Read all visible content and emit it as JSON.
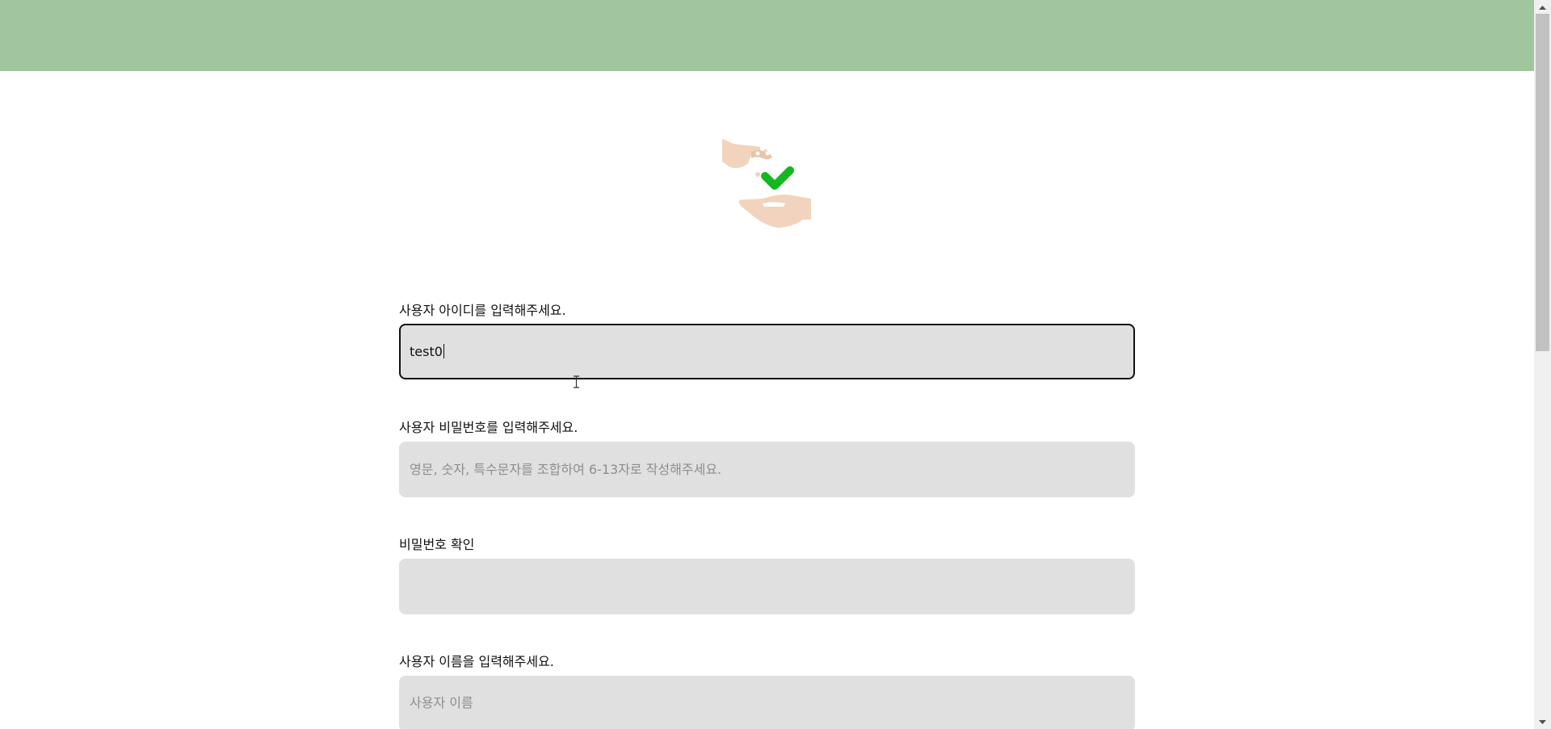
{
  "form": {
    "user_id": {
      "label": "사용자 아이디를 입력해주세요.",
      "value": "test0",
      "placeholder": ""
    },
    "password": {
      "label": "사용자 비밀번호를 입력해주세요.",
      "value": "",
      "placeholder": "영문, 숫자, 특수문자를 조합하여 6-13자로 작성해주세요."
    },
    "password_confirm": {
      "label": "비밀번호 확인",
      "value": "",
      "placeholder": ""
    },
    "user_name": {
      "label": "사용자 이름을 입력해주세요.",
      "value": "",
      "placeholder": "사용자 이름"
    }
  },
  "colors": {
    "banner": "#a1c59d",
    "input_background": "#e0e0e0",
    "check_green": "#12b81e",
    "hand_skin": "#f2d3bd"
  },
  "icons": {
    "logo": "hands-with-check-icon"
  }
}
